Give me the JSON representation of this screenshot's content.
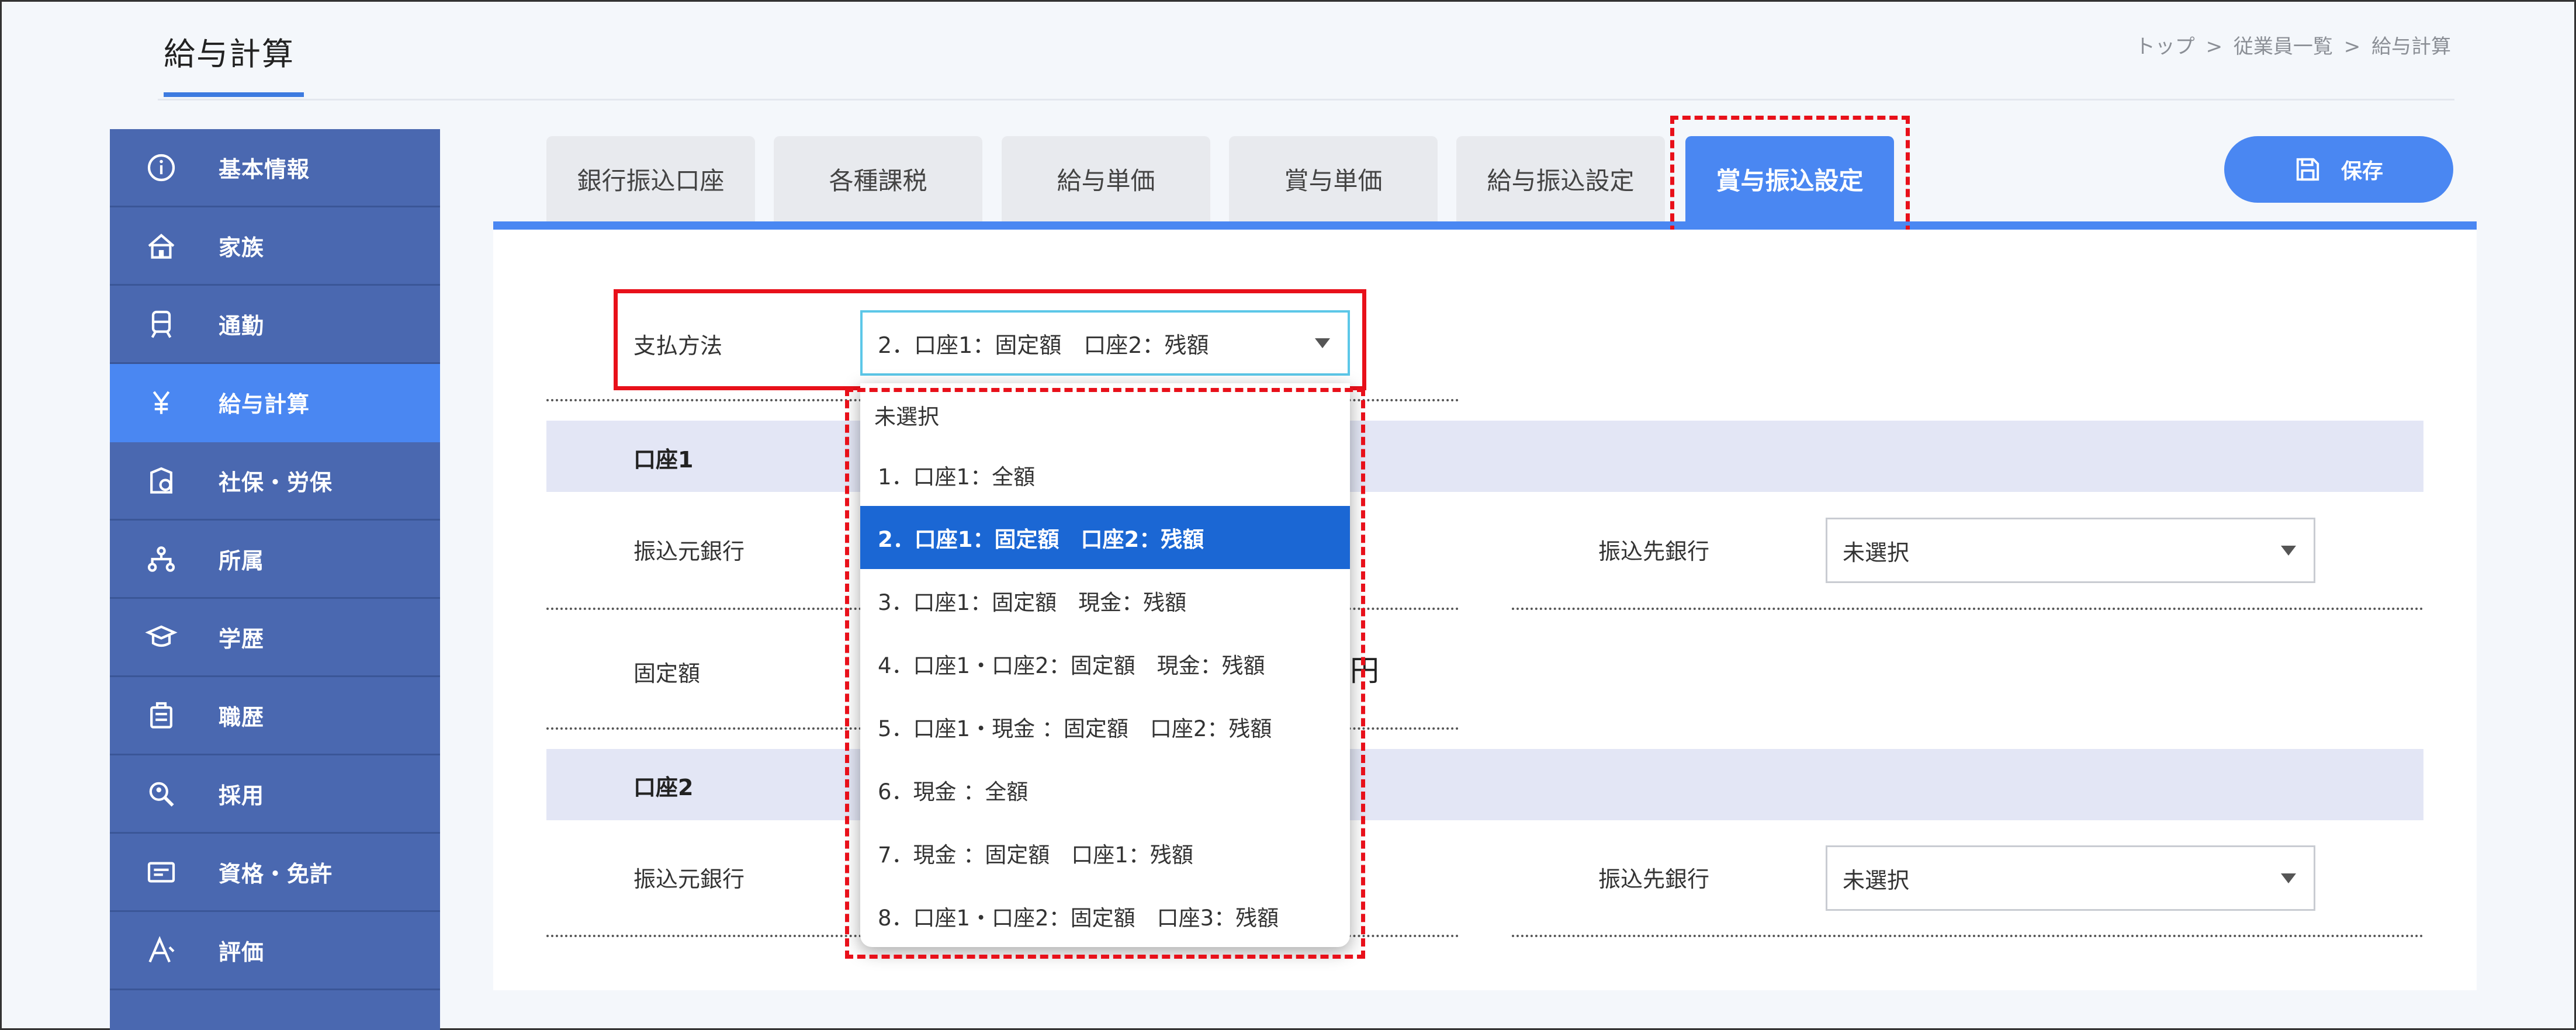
{
  "header": {
    "title": "給与計算",
    "breadcrumb": [
      "トップ",
      "従業員一覧",
      "給与計算"
    ],
    "breadcrumb_sep": ">"
  },
  "sidebar": {
    "items": [
      {
        "label": "基本情報",
        "icon": "info-icon"
      },
      {
        "label": "家族",
        "icon": "house-icon"
      },
      {
        "label": "通勤",
        "icon": "train-icon"
      },
      {
        "label": "給与計算",
        "icon": "yen-icon",
        "active": true
      },
      {
        "label": "社保・労保",
        "icon": "insurance-icon"
      },
      {
        "label": "所属",
        "icon": "org-chart-icon"
      },
      {
        "label": "学歴",
        "icon": "graduation-cap-icon"
      },
      {
        "label": "職歴",
        "icon": "briefcase-icon"
      },
      {
        "label": "採用",
        "icon": "magnifier-icon"
      },
      {
        "label": "資格・免許",
        "icon": "license-card-icon"
      },
      {
        "label": "評価",
        "icon": "rating-icon"
      }
    ]
  },
  "tabs": [
    {
      "label": "銀行振込口座"
    },
    {
      "label": "各種課税"
    },
    {
      "label": "給与単価"
    },
    {
      "label": "賞与単価"
    },
    {
      "label": "給与振込設定"
    },
    {
      "label": "賞与振込設定",
      "active": true
    }
  ],
  "toolbar": {
    "save_label": "保存"
  },
  "form": {
    "payment_method_label": "支払方法",
    "payment_method_value": "2．口座1：固定額　口座2：残額",
    "account1_title": "口座1",
    "account2_title": "口座2",
    "source_bank_label": "振込元銀行",
    "dest_bank_label": "振込先銀行",
    "dest_bank1_value": "未選択",
    "dest_bank2_value": "未選択",
    "fixed_amount_label": "固定額",
    "yen_unit": "円"
  },
  "dropdown": {
    "options": [
      "未選択",
      "1．口座1：全額",
      "2．口座1：固定額　口座2：残額",
      "3．口座1：固定額　現金：残額",
      "4．口座1・口座2：固定額　現金：残額",
      "5．口座1・現金 ：固定額　口座2：残額",
      "6．現金 ：全額",
      "7．現金 ：固定額　口座1：残額",
      "8．口座1・口座2：固定額　口座3：残額"
    ],
    "selected_index": 2
  },
  "colors": {
    "accent": "#4a87f2",
    "sidebar": "#4a68b0",
    "selected_option": "#1b67d4",
    "annotation": "#e8101a"
  }
}
